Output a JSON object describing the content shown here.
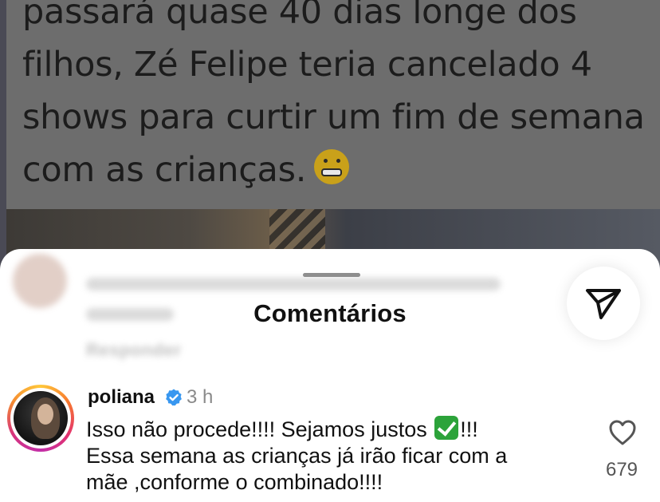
{
  "post": {
    "lines": [
      "passará quase 40 dias longe dos",
      "filhos, Zé Felipe teria cancelado 4",
      "shows para curtir um fim de semana",
      "com as crianças."
    ],
    "emoji": "grimacing-face"
  },
  "comments_sheet": {
    "title": "Comentários",
    "blurred_reply_label": "Responder",
    "share_icon": "send-icon"
  },
  "comment": {
    "username": "poliana",
    "verified": true,
    "time": "3 h",
    "line1_start": "Isso não procede!!!! Sejamos justos",
    "line1_emoji": "check-mark-button",
    "line1_end": "!!!",
    "line2": "Essa semana as crianças já irão ficar com a",
    "line3": "mãe ,conforme o combinado!!!!",
    "like_icon": "heart-icon",
    "likes": "679"
  },
  "colors": {
    "verified": "#3897f0",
    "text": "#111111",
    "muted": "#8a8a8a"
  }
}
